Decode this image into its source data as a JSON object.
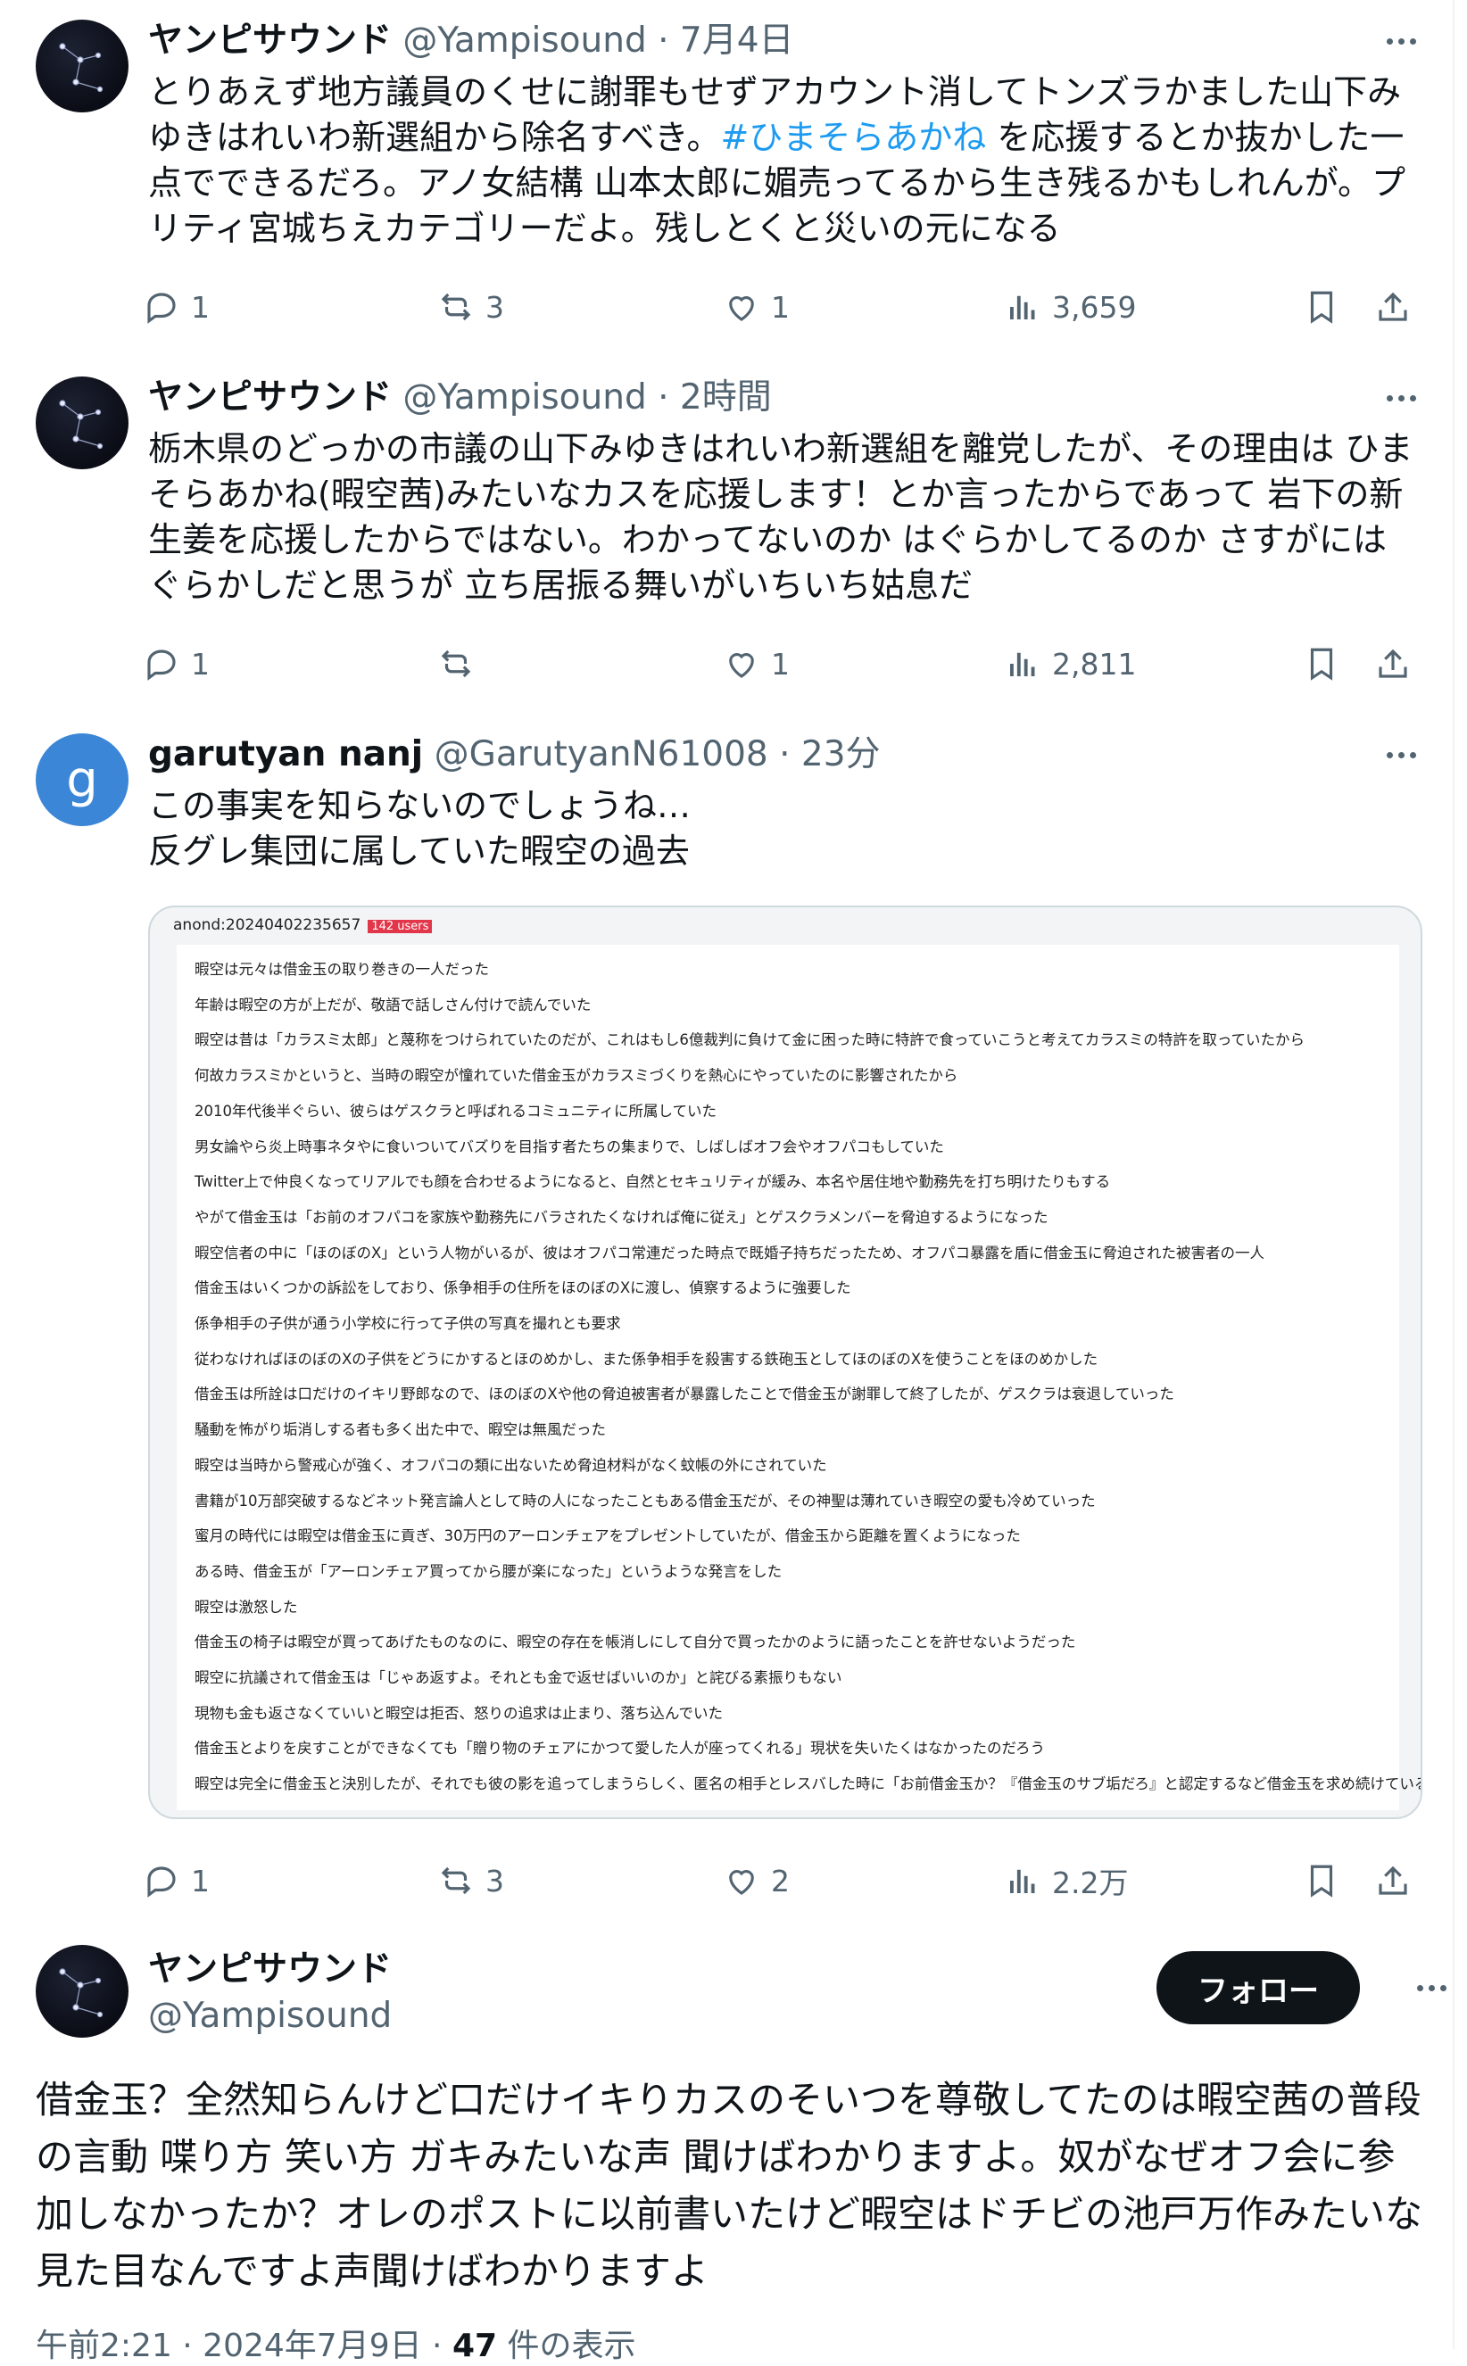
{
  "posts": [
    {
      "name": "ヤンピサウンド",
      "handle": "@Yampisound",
      "time": "· 7月4日",
      "text_a": "とりあえず地方議員のくせに謝罪もせずアカウント消してトンズラかました山下みゆきはれいわ新選組から除名すべき。",
      "hashtag": "#ひまそらあかね",
      "text_b": " を応援するとか抜かした一点でできるだろ。アノ女結構 山本太郎に媚売ってるから生き残るかもしれんが。プリティ宮城ちえカテゴリーだよ。残しとくと災いの元になる",
      "replies": "1",
      "reposts": "3",
      "likes": "1",
      "views": "3,659"
    },
    {
      "name": "ヤンピサウンド",
      "handle": "@Yampisound",
      "time": "· 2時間",
      "text": "栃木県のどっかの市議の山下みゆきはれいわ新選組を離党したが、その理由は ひまそらあかね(暇空茜)みたいなカスを応援します！とか言ったからであって 岩下の新生姜を応援したからではない。わかってないのか はぐらかしてるのか さすがにはぐらかしだと思うが 立ち居振る舞いがいちいち姑息だ",
      "replies": "1",
      "reposts": "",
      "likes": "1",
      "views": "2,811"
    },
    {
      "avatar_letter": "g",
      "name": "garutyan nanj",
      "handle": "@GarutyanN61008",
      "time": "· 23分",
      "text_line1": "この事実を知らないのでしょうね…",
      "text_line2": "反グレ集団に属していた暇空の過去",
      "replies": "1",
      "reposts": "3",
      "likes": "2",
      "views": "2.2万"
    }
  ],
  "embedded_image": {
    "header": "anond:20240402235657",
    "badge": "142 users",
    "lines": [
      "暇空は元々は借金玉の取り巻きの一人だった",
      "年齢は暇空の方が上だが、敬語で話しさん付けで読んでいた",
      "暇空は昔は「カラスミ太郎」と蔑称をつけられていたのだが、これはもし6億裁判に負けて金に困った時に特許で食っていこうと考えてカラスミの特許を取っていたから",
      "何故カラスミかというと、当時の暇空が憧れていた借金玉がカラスミづくりを熱心にやっていたのに影響されたから",
      "2010年代後半ぐらい、彼らはゲスクラと呼ばれるコミュニティに所属していた",
      "男女論やら炎上時事ネタやに食いついてバズりを目指す者たちの集まりで、しばしばオフ会やオフパコもしていた",
      "Twitter上で仲良くなってリアルでも顔を合わせるようになると、自然とセキュリティが緩み、本名や居住地や勤務先を打ち明けたりもする",
      "やがて借金玉は「お前のオフパコを家族や勤務先にバラされたくなければ俺に従え」とゲスクラメンバーを脅迫するようになった",
      "暇空信者の中に「ほのぼのX」という人物がいるが、彼はオフパコ常連だった時点で既婚子持ちだったため、オフパコ暴露を盾に借金玉に脅迫された被害者の一人",
      "借金玉はいくつかの訴訟をしており、係争相手の住所をほのぼのXに渡し、偵察するように強要した",
      "係争相手の子供が通う小学校に行って子供の写真を撮れとも要求",
      "従わなければほのぼのXの子供をどうにかするとほのめかし、また係争相手を殺害する鉄砲玉としてほのぼのXを使うことをほのめかした",
      "借金玉は所詮は口だけのイキリ野郎なので、ほのぼのXや他の脅迫被害者が暴露したことで借金玉が謝罪して終了したが、ゲスクラは衰退していった",
      "騒動を怖がり垢消しする者も多く出た中で、暇空は無風だった",
      "暇空は当時から警戒心が強く、オフパコの類に出ないため脅迫材料がなく蚊帳の外にされていた",
      "書籍が10万部突破するなどネット発言論人として時の人になったこともある借金玉だが、その神聖は薄れていき暇空の愛も冷めていった",
      "蜜月の時代には暇空は借金玉に貢ぎ、30万円のアーロンチェアをプレゼントしていたが、借金玉から距離を置くようになった",
      "ある時、借金玉が「アーロンチェア買ってから腰が楽になった」というような発言をした",
      "暇空は激怒した",
      "借金玉の椅子は暇空が買ってあげたものなのに、暇空の存在を帳消しにして自分で買ったかのように語ったことを許せないようだった",
      "暇空に抗議されて借金玉は「じゃあ返すよ。それとも金で返せばいいのか」と詫びる素振りもない",
      "現物も金も返さなくていいと暇空は拒否、怒りの追求は止まり、落ち込んでいた",
      "借金玉とよりを戻すことができなくても「贈り物のチェアにかつて愛した人が座ってくれる」現状を失いたくはなかったのだろう",
      "暇空は完全に借金玉と決別したが、それでも彼の影を追ってしまうらしく、匿名の相手とレスバした時に「お前借金玉か？『借金玉のサブ垢だろ』と認定するなど借金玉を求め続けている"
    ]
  },
  "main_post": {
    "name": "ヤンピサウンド",
    "handle": "@Yampisound",
    "follow_label": "フォロー",
    "text": "借金玉？全然知らんけど口だけイキりカスのそいつを尊敬してたのは暇空茜の普段の言動 喋り方 笑い方 ガキみたいな声 聞けばわかりますよ。奴がなぜオフ会に参加しなかったか？オレのポストに以前書いたけど暇空はドチビの池戸万作みたいな見た目なんですよ声聞けばわかりますよ",
    "time": "午前2:21 · 2024年7月9日 · ",
    "view_count": "47",
    "view_suffix": " 件の表示"
  },
  "colors": {
    "accent": "#1d9bf0",
    "muted": "#536471",
    "text": "#0f1419",
    "follow_bg": "#0f1419"
  },
  "icons": [
    "reply-icon",
    "repost-icon",
    "like-icon",
    "views-icon",
    "bookmark-icon",
    "share-icon",
    "more-icon"
  ]
}
